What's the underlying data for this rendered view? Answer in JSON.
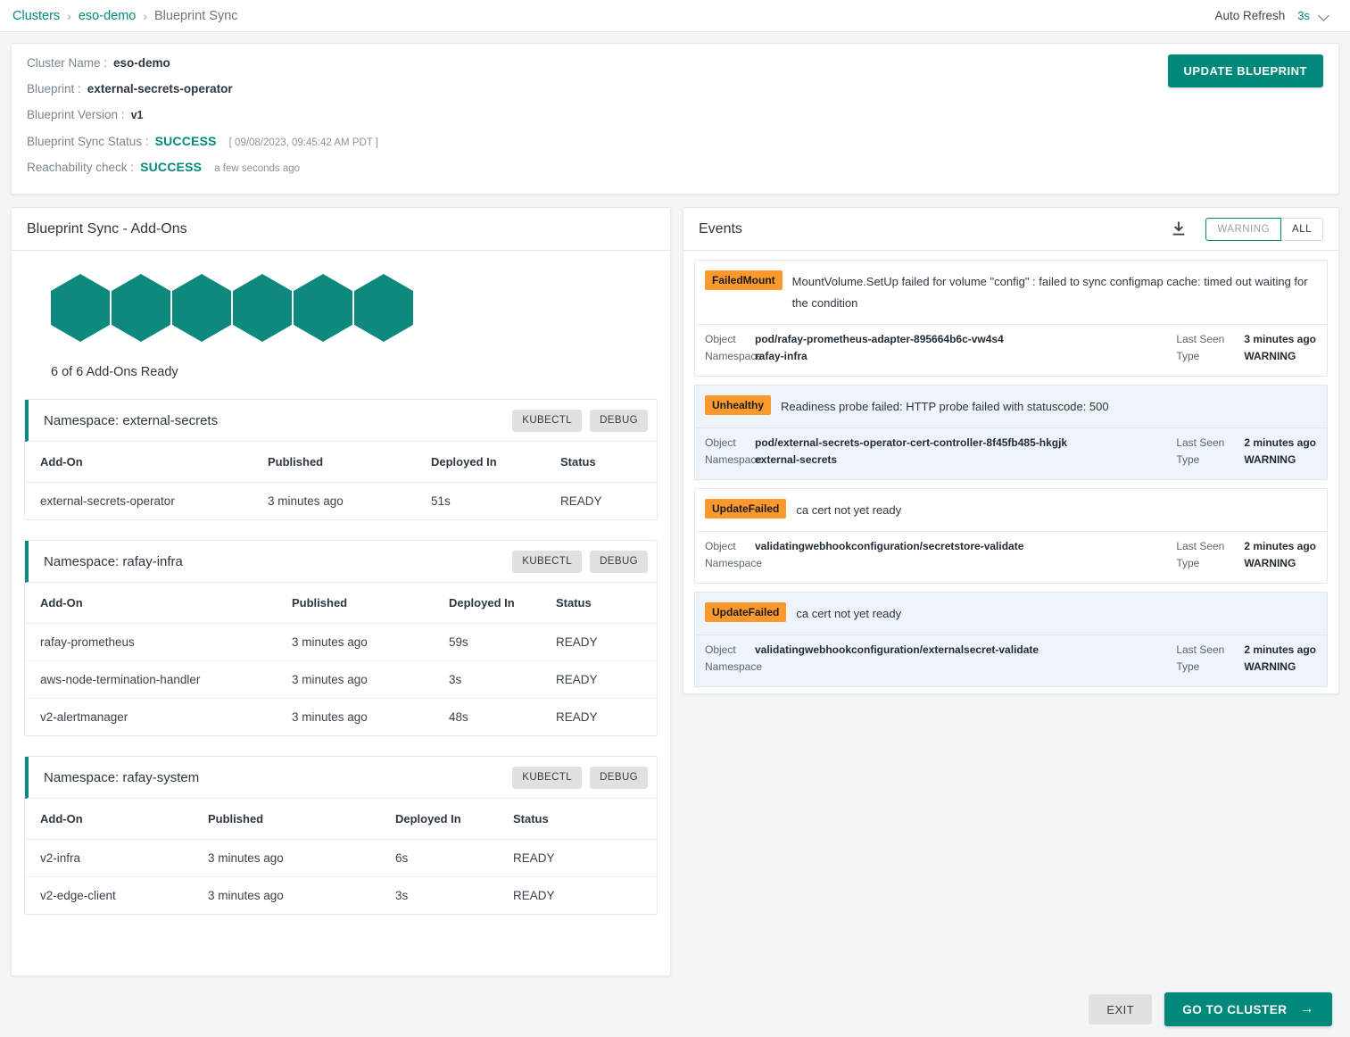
{
  "breadcrumb": {
    "root": "Clusters",
    "cluster": "eso-demo",
    "current": "Blueprint Sync",
    "separator": "›"
  },
  "auto_refresh": {
    "label": "Auto Refresh",
    "value": "3s",
    "icon": "chevron-down-icon"
  },
  "cluster_info": {
    "cluster_name_label": "Cluster Name :",
    "cluster_name_value": "eso-demo",
    "blueprint_label": "Blueprint :",
    "blueprint_value": "external-secrets-operator",
    "blueprint_version_label": "Blueprint Version :",
    "blueprint_version_value": "v1",
    "sync_status_label": "Blueprint Sync Status :",
    "sync_status_value": "SUCCESS",
    "sync_timestamp": "[ 09/08/2023, 09:45:42 AM PDT ]",
    "reachability_label": "Reachability check :",
    "reachability_value": "SUCCESS",
    "reachability_ago": "a few seconds ago",
    "update_button": "UPDATE BLUEPRINT"
  },
  "addons_panel": {
    "title": "Blueprint Sync - Add-Ons",
    "hexagon_count": 6,
    "ready_text": "6 of 6 Add-Ons Ready",
    "buttons": {
      "kubectl": "KUBECTL",
      "debug": "DEBUG"
    },
    "columns": [
      "Add-On",
      "Published",
      "Deployed In",
      "Status"
    ],
    "namespaces": [
      {
        "title": "Namespace: external-secrets",
        "col_widths": [
          "272px",
          "183px",
          "145px",
          "auto"
        ],
        "rows": [
          {
            "addon": "external-secrets-operator",
            "published": "3 minutes ago",
            "deployed_in": "51s",
            "status": "READY"
          }
        ]
      },
      {
        "title": "Namespace: rafay-infra",
        "col_widths": [
          "299px",
          "176px",
          "120px",
          "auto"
        ],
        "rows": [
          {
            "addon": "rafay-prometheus",
            "published": "3 minutes ago",
            "deployed_in": "59s",
            "status": "READY"
          },
          {
            "addon": "aws-node-termination-handler",
            "published": "3 minutes ago",
            "deployed_in": "3s",
            "status": "READY"
          },
          {
            "addon": "v2-alertmanager",
            "published": "3 minutes ago",
            "deployed_in": "48s",
            "status": "READY"
          }
        ]
      },
      {
        "title": "Namespace: rafay-system",
        "col_widths": [
          "205px",
          "210px",
          "132px",
          "auto"
        ],
        "rows": [
          {
            "addon": "v2-infra",
            "published": "3 minutes ago",
            "deployed_in": "6s",
            "status": "READY"
          },
          {
            "addon": "v2-edge-client",
            "published": "3 minutes ago",
            "deployed_in": "3s",
            "status": "READY"
          }
        ]
      }
    ]
  },
  "events_panel": {
    "title": "Events",
    "download_icon": "download-icon",
    "filter": {
      "warning": "WARNING",
      "all": "ALL",
      "selected": "WARNING"
    },
    "meta_labels": {
      "object": "Object",
      "namespace": "Namespace",
      "last_seen": "Last Seen",
      "type": "Type"
    },
    "events": [
      {
        "badge": "FailedMount",
        "message": "MountVolume.SetUp failed for volume \"config\" : failed to sync configmap cache: timed out waiting for the condition",
        "object": "pod/rafay-prometheus-adapter-895664b6c-vw4s4",
        "namespace": "rafay-infra",
        "last_seen": "3 minutes ago",
        "type": "WARNING",
        "highlight": false
      },
      {
        "badge": "Unhealthy",
        "message": "Readiness probe failed: HTTP probe failed with statuscode: 500",
        "object": "pod/external-secrets-operator-cert-controller-8f45fb485-hkgjk",
        "namespace": "external-secrets",
        "last_seen": "2 minutes ago",
        "type": "WARNING",
        "highlight": true
      },
      {
        "badge": "UpdateFailed",
        "message": "ca cert not yet ready",
        "object": "validatingwebhookconfiguration/secretstore-validate",
        "namespace": "",
        "last_seen": "2 minutes ago",
        "type": "WARNING",
        "highlight": false
      },
      {
        "badge": "UpdateFailed",
        "message": "ca cert not yet ready",
        "object": "validatingwebhookconfiguration/externalsecret-validate",
        "namespace": "",
        "last_seen": "2 minutes ago",
        "type": "WARNING",
        "highlight": true
      }
    ]
  },
  "footer": {
    "exit": "EXIT",
    "goto_cluster": "GO TO CLUSTER",
    "arrow": "→"
  },
  "colors": {
    "accent": "#00897b",
    "hexagon": "#0d8a7d",
    "badge": "#f9992e",
    "highlight_bg": "#eef4fa"
  }
}
